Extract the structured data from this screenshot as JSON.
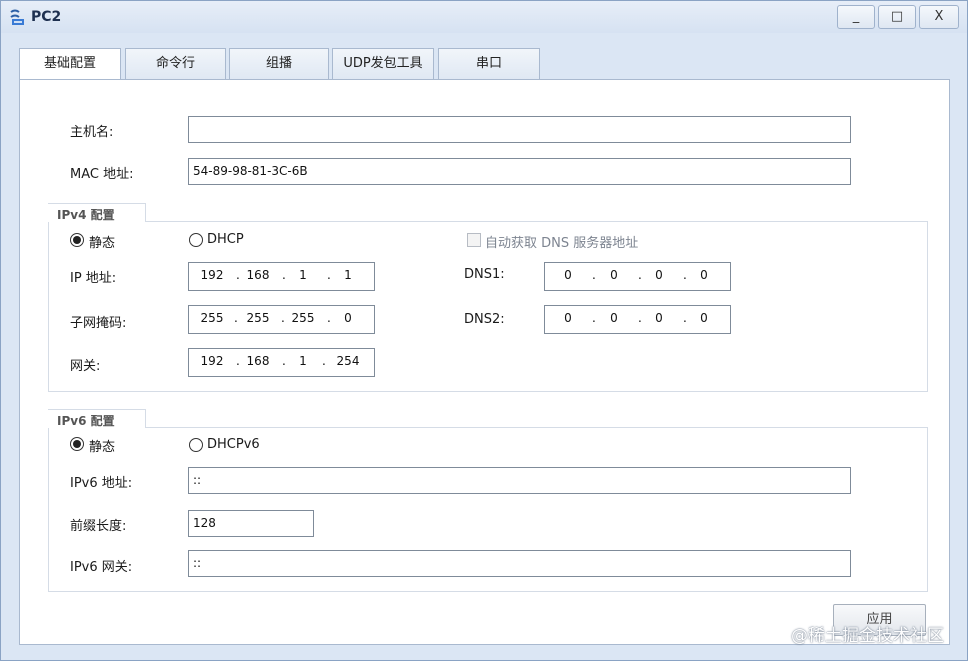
{
  "window": {
    "title": "PC2",
    "min_icon": "_",
    "max_icon": "□",
    "close_icon": "X"
  },
  "tabs": [
    "基础配置",
    "命令行",
    "组播",
    "UDP发包工具",
    "串口"
  ],
  "basic": {
    "hostname_label": "主机名:",
    "hostname_value": "",
    "mac_label": "MAC 地址:",
    "mac_value": "54-89-98-81-3C-6B"
  },
  "ipv4": {
    "group_title": "IPv4 配置",
    "static_label": "静态",
    "dhcp_label": "DHCP",
    "mode": "static",
    "auto_dns_label": "自动获取 DNS 服务器地址",
    "ip_label": "IP 地址:",
    "ip": [
      "192",
      "168",
      "1",
      "1"
    ],
    "mask_label": "子网掩码:",
    "mask": [
      "255",
      "255",
      "255",
      "0"
    ],
    "gateway_label": "网关:",
    "gateway": [
      "192",
      "168",
      "1",
      "254"
    ],
    "dns1_label": "DNS1:",
    "dns1": [
      "0",
      "0",
      "0",
      "0"
    ],
    "dns2_label": "DNS2:",
    "dns2": [
      "0",
      "0",
      "0",
      "0"
    ]
  },
  "ipv6": {
    "group_title": "IPv6 配置",
    "static_label": "静态",
    "dhcp_label": "DHCPv6",
    "mode": "static",
    "addr_label": "IPv6 地址:",
    "addr_value": "::",
    "prefix_label": "前缀长度:",
    "prefix_value": "128",
    "gateway_label": "IPv6 网关:",
    "gateway_value": "::"
  },
  "apply_label": "应用",
  "watermark": "@稀土掘金技术社区"
}
